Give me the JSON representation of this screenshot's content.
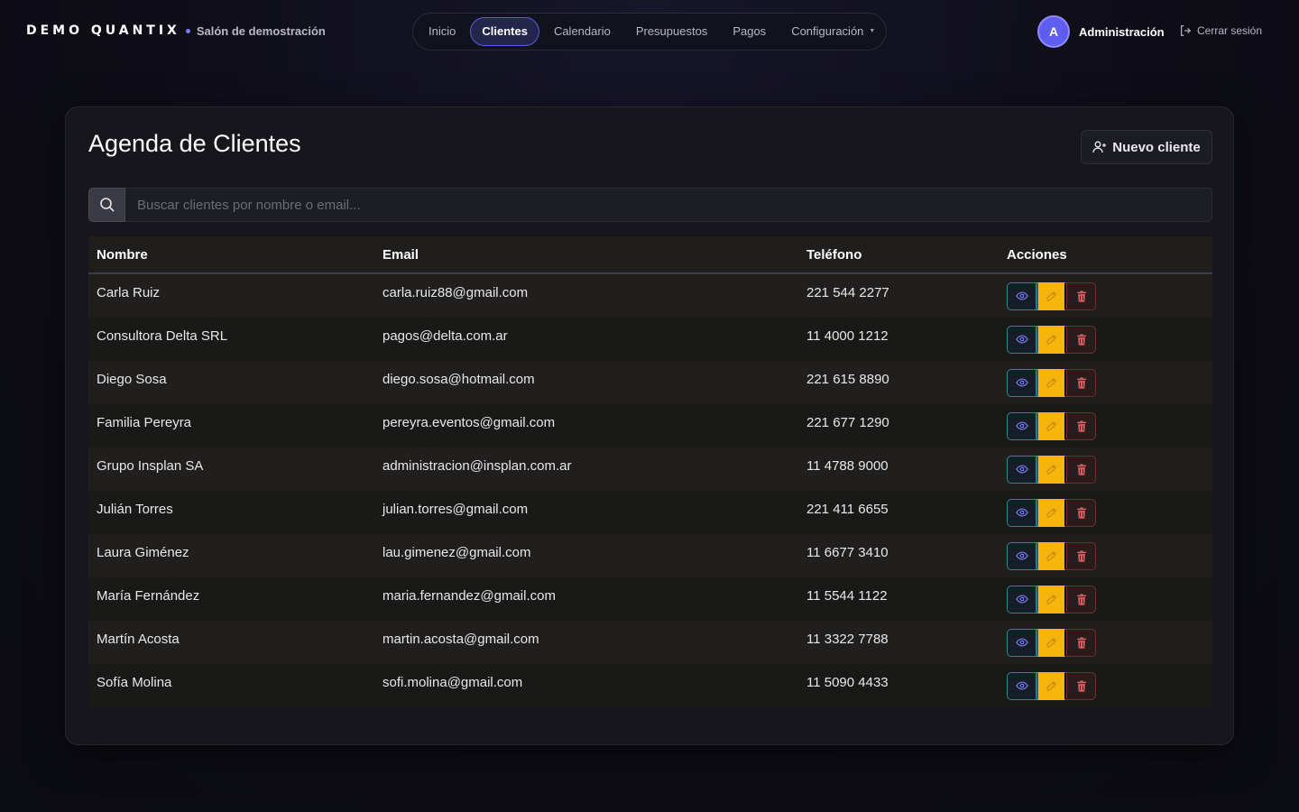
{
  "brand": {
    "name": "DEMO QUANTIX",
    "subtitle": "Salón de demostración"
  },
  "nav": {
    "items": [
      {
        "label": "Inicio",
        "active": false
      },
      {
        "label": "Clientes",
        "active": true
      },
      {
        "label": "Calendario",
        "active": false
      },
      {
        "label": "Presupuestos",
        "active": false
      },
      {
        "label": "Pagos",
        "active": false
      },
      {
        "label": "Configuración",
        "active": false,
        "dropdown": true
      }
    ]
  },
  "user": {
    "initial": "A",
    "name": "Administración",
    "logout_label": "Cerrar sesión"
  },
  "page": {
    "title": "Agenda de Clientes",
    "new_button_label": "Nuevo cliente"
  },
  "search": {
    "placeholder": "Buscar clientes por nombre o email...",
    "value": ""
  },
  "table": {
    "headers": [
      "Nombre",
      "Email",
      "Teléfono",
      "Acciones"
    ],
    "rows": [
      {
        "name": "Carla Ruiz",
        "email": "carla.ruiz88@gmail.com",
        "phone": "221 544 2277"
      },
      {
        "name": "Consultora Delta SRL",
        "email": "pagos@delta.com.ar",
        "phone": "11 4000 1212"
      },
      {
        "name": "Diego Sosa",
        "email": "diego.sosa@hotmail.com",
        "phone": "221 615 8890"
      },
      {
        "name": "Familia Pereyra",
        "email": "pereyra.eventos@gmail.com",
        "phone": "221 677 1290"
      },
      {
        "name": "Grupo Insplan SA",
        "email": "administracion@insplan.com.ar",
        "phone": "11 4788 9000"
      },
      {
        "name": "Julián Torres",
        "email": "julian.torres@gmail.com",
        "phone": "221 411 6655"
      },
      {
        "name": "Laura Giménez",
        "email": "lau.gimenez@gmail.com",
        "phone": "11 6677 3410"
      },
      {
        "name": "María Fernández",
        "email": "maria.fernandez@gmail.com",
        "phone": "11 5544 1122"
      },
      {
        "name": "Martín Acosta",
        "email": "martin.acosta@gmail.com",
        "phone": "11 3322 7788"
      },
      {
        "name": "Sofía Molina",
        "email": "sofi.molina@gmail.com",
        "phone": "11 5090 4433"
      }
    ],
    "row_actions": [
      "eye-icon",
      "pencil-icon",
      "trash-icon"
    ]
  },
  "colors": {
    "accent": "#5f5cf0",
    "view_border": "#2b8a8f",
    "edit_bg": "#f5b50c",
    "delete_border": "#7a2a2e",
    "delete_icon": "#e25c66"
  }
}
